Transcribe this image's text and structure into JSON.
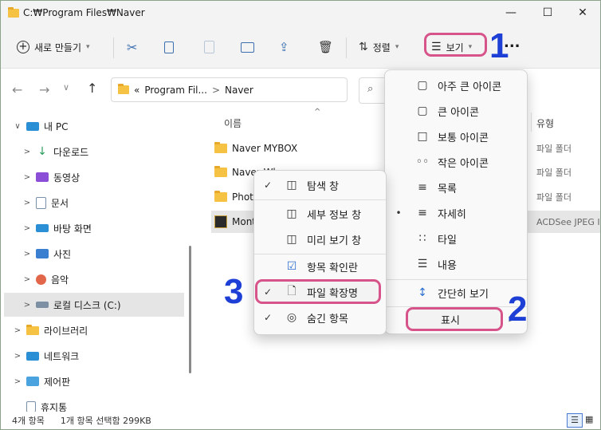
{
  "window": {
    "title": "C:₩Program Files₩Naver",
    "minimize_glyph": "—",
    "maximize_glyph": "☐",
    "close_glyph": "✕"
  },
  "toolbar": {
    "new_label": "새로 만들기",
    "sort_label": "정렬",
    "view_label": "보기",
    "more_label": "..."
  },
  "address": {
    "prefix": "«",
    "crumb1": "Program Fil...",
    "sep": ">",
    "crumb2": "Naver"
  },
  "nav": {
    "items": [
      {
        "label": "내 PC",
        "arrow": "∨"
      },
      {
        "label": "다운로드",
        "arrow": ">"
      },
      {
        "label": "동영상",
        "arrow": ">"
      },
      {
        "label": "문서",
        "arrow": ">"
      },
      {
        "label": "바탕 화면",
        "arrow": ">"
      },
      {
        "label": "사진",
        "arrow": ">"
      },
      {
        "label": "음악",
        "arrow": ">"
      },
      {
        "label": "로컬 디스크 (C:)",
        "arrow": ">"
      },
      {
        "label": "라이브러리",
        "arrow": ">"
      },
      {
        "label": "네트워크",
        "arrow": ">"
      },
      {
        "label": "제어판",
        "arrow": ">"
      },
      {
        "label": "휴지통",
        "arrow": ""
      }
    ]
  },
  "content": {
    "col_name": "이름",
    "col_type": "유형",
    "rows": [
      {
        "name": "Naver MYBOX",
        "type": "파일 폴더"
      },
      {
        "name": "Naver Wh",
        "type": "파일 폴더"
      },
      {
        "name": "Photo",
        "type": "파일 폴더"
      },
      {
        "name": "Mont",
        "type": "ACDSee JPEG I"
      }
    ]
  },
  "status": {
    "count": "4개 항목",
    "selection": "1개 항목 선택함 299KB"
  },
  "view_menu": {
    "items": [
      {
        "icon": "▢",
        "label": "아주 큰 아이콘"
      },
      {
        "icon": "▢",
        "label": "큰 아이콘"
      },
      {
        "icon": "□",
        "label": "보통 아이콘"
      },
      {
        "icon": "◦◦",
        "label": "작은 아이콘"
      },
      {
        "icon": "≡",
        "label": "목록"
      },
      {
        "icon": "≡",
        "label": "자세히",
        "bullet": "•"
      },
      {
        "icon": "∷",
        "label": "타일"
      },
      {
        "icon": "☰",
        "label": "내용"
      },
      {
        "icon": "↕",
        "label": "간단히 보기"
      },
      {
        "label": "표시",
        "chevron": ">"
      }
    ]
  },
  "show_menu": {
    "items": [
      {
        "check": "✓",
        "icon": "◫",
        "label": "탐색 창"
      },
      {
        "check": "",
        "icon": "◫",
        "label": "세부 정보 창"
      },
      {
        "check": "",
        "icon": "◫",
        "label": "미리 보기 창"
      },
      {
        "check": "",
        "icon": "☑",
        "label": "항목 확인란"
      },
      {
        "check": "✓",
        "icon": "🗋",
        "label": "파일 확장명"
      },
      {
        "check": "✓",
        "icon": "◎",
        "label": "숨긴 항목"
      }
    ]
  },
  "annotations": {
    "one": "1",
    "two": "2",
    "three": "3"
  },
  "colors": {
    "highlight": "#d7548a",
    "annotation_number": "#1d3fd6",
    "folder": "#f5c244"
  }
}
